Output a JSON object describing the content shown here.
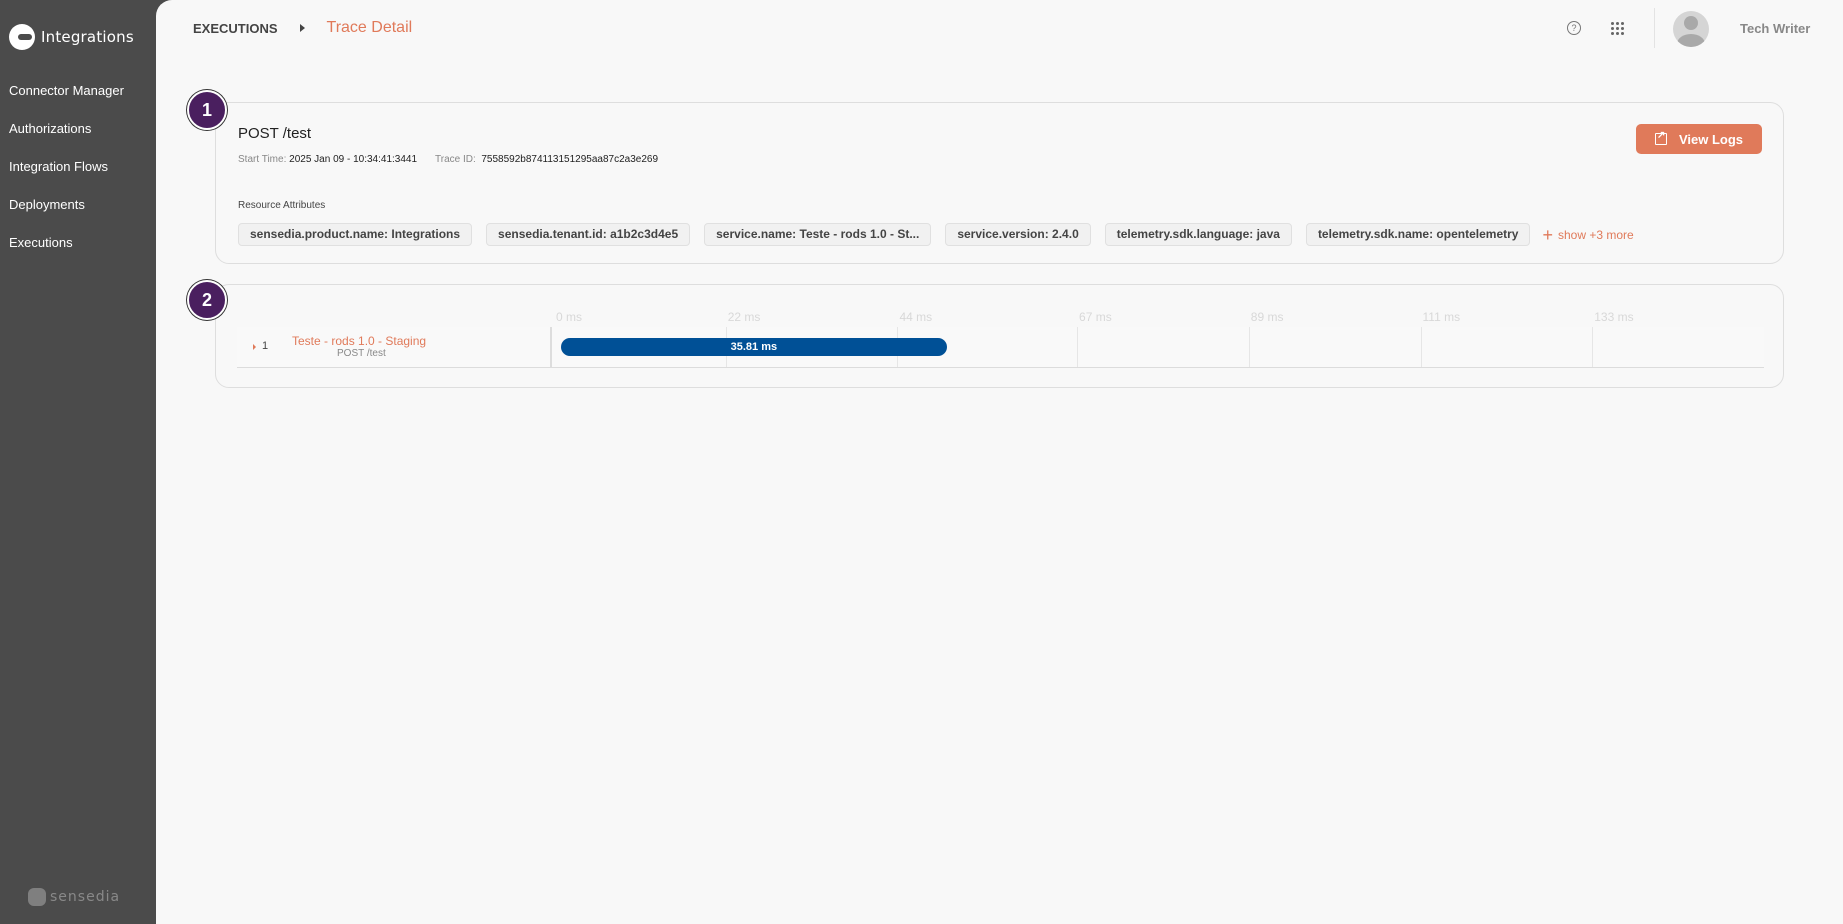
{
  "sidebar": {
    "logo_text": "Integrations",
    "items": [
      {
        "label": "Connector Manager"
      },
      {
        "label": "Authorizations"
      },
      {
        "label": "Integration Flows"
      },
      {
        "label": "Deployments"
      },
      {
        "label": "Executions"
      }
    ],
    "footer_brand": "sensedia"
  },
  "header": {
    "breadcrumb_parent": "EXECUTIONS",
    "breadcrumb_current": "Trace Detail",
    "help_icon": "question-circle-icon",
    "apps_icon": "grid-dots-icon",
    "user_name": "Tech Writer"
  },
  "steps": [
    "1",
    "2"
  ],
  "trace": {
    "title": "POST /test",
    "start_time_label": "Start Time:",
    "start_time_value": "2025 Jan 09 - 10:34:41:3441",
    "trace_id_label": "Trace ID:",
    "trace_id_value": "7558592b874113151295aa87c2a3e269",
    "view_logs_label": "View Logs",
    "resource_attributes_label": "Resource Attributes",
    "attributes": [
      "sensedia.product.name: Integrations",
      "sensedia.tenant.id: a1b2c3d4e5",
      "service.name: Teste - rods 1.0 - St...",
      "service.version: 2.4.0",
      "telemetry.sdk.language: java",
      "telemetry.sdk.name: opentelemetry"
    ],
    "show_more_label": "show +3 more"
  },
  "timeline": {
    "max_ms": 155,
    "ticks": [
      {
        "value": 0,
        "label": "0 ms"
      },
      {
        "value": 22,
        "label": "22 ms"
      },
      {
        "value": 44,
        "label": "44 ms"
      },
      {
        "value": 67,
        "label": "67 ms"
      },
      {
        "value": 89,
        "label": "89 ms"
      },
      {
        "value": 111,
        "label": "111 ms"
      },
      {
        "value": 133,
        "label": "133 ms"
      }
    ],
    "spans": [
      {
        "index": "1",
        "name": "Teste - rods 1.0 - Staging",
        "operation": "POST /test",
        "start_ms": 0,
        "duration_ms": 35.81,
        "duration_label": "35.81 ms",
        "color": "#005096"
      }
    ]
  },
  "colors": {
    "accent": "#e07a5a",
    "step_badge": "#4a1f5f",
    "sidebar": "#4b4b4b"
  }
}
